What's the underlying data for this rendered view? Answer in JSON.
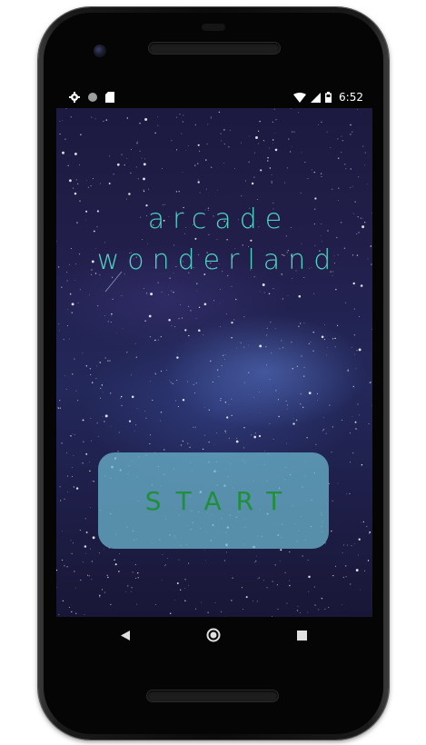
{
  "status_bar": {
    "time": "6:52",
    "left_icons": [
      "gear-icon",
      "circle-icon",
      "sd-card-icon"
    ],
    "right_icons": [
      "wifi-icon",
      "cell-signal-icon",
      "battery-icon"
    ]
  },
  "app": {
    "title_line1": "arcade",
    "title_line2": "wonderland",
    "start_label": "START"
  },
  "nav_bar": {
    "buttons": [
      "back-icon",
      "home-icon",
      "recents-icon"
    ]
  },
  "colors": {
    "title": "#4fd2c1",
    "start_button_bg": "#68b0c8",
    "start_label": "#1f8f3a",
    "background": "#221f4c"
  }
}
